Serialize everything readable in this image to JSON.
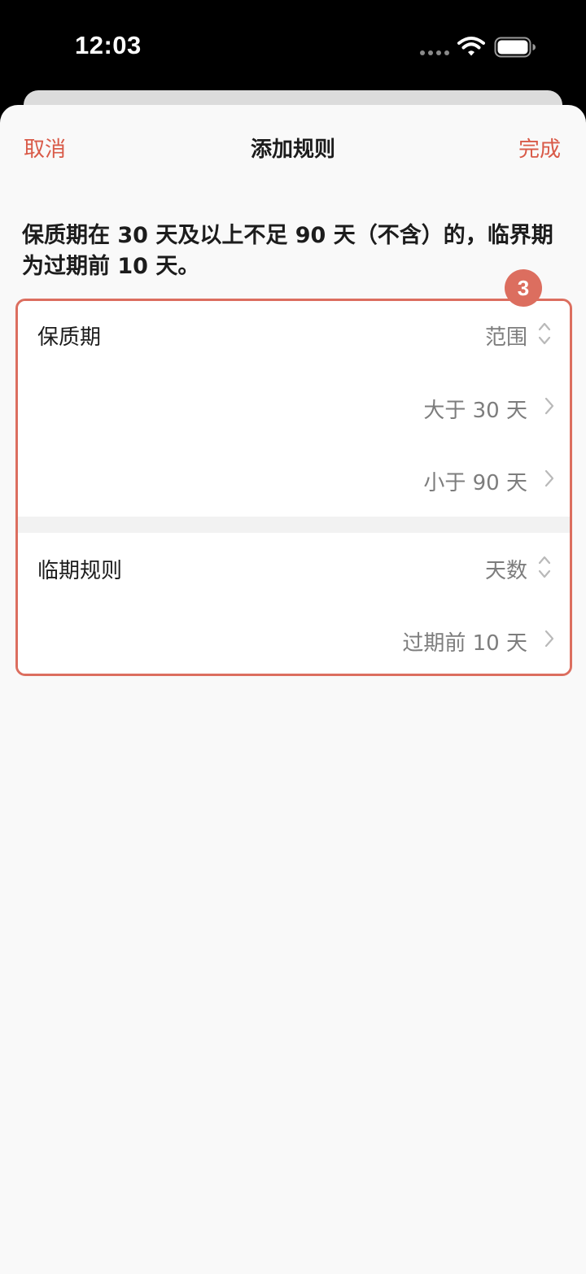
{
  "status_bar": {
    "time": "12:03",
    "icons": [
      "signal-dots-icon",
      "wifi-icon",
      "battery-icon"
    ]
  },
  "nav": {
    "cancel_label": "取消",
    "title": "添加规则",
    "done_label": "完成"
  },
  "description": "保质期在 30 天及以上不足 90 天（不含）的，临界期为过期前 10 天。",
  "form": {
    "shelf_life": {
      "label": "保质期",
      "mode": "范围",
      "min_row": "大于 30 天",
      "max_row": "小于 90 天"
    },
    "expiry_rule": {
      "label": "临期规则",
      "mode": "天数",
      "days_row": "过期前 10 天"
    }
  },
  "step_badge": "3",
  "colors": {
    "accent": "#d95a48",
    "highlight_border": "#dc6e5f",
    "sheet_background": "#f9f9f9",
    "muted_text": "#7d7d7d"
  }
}
